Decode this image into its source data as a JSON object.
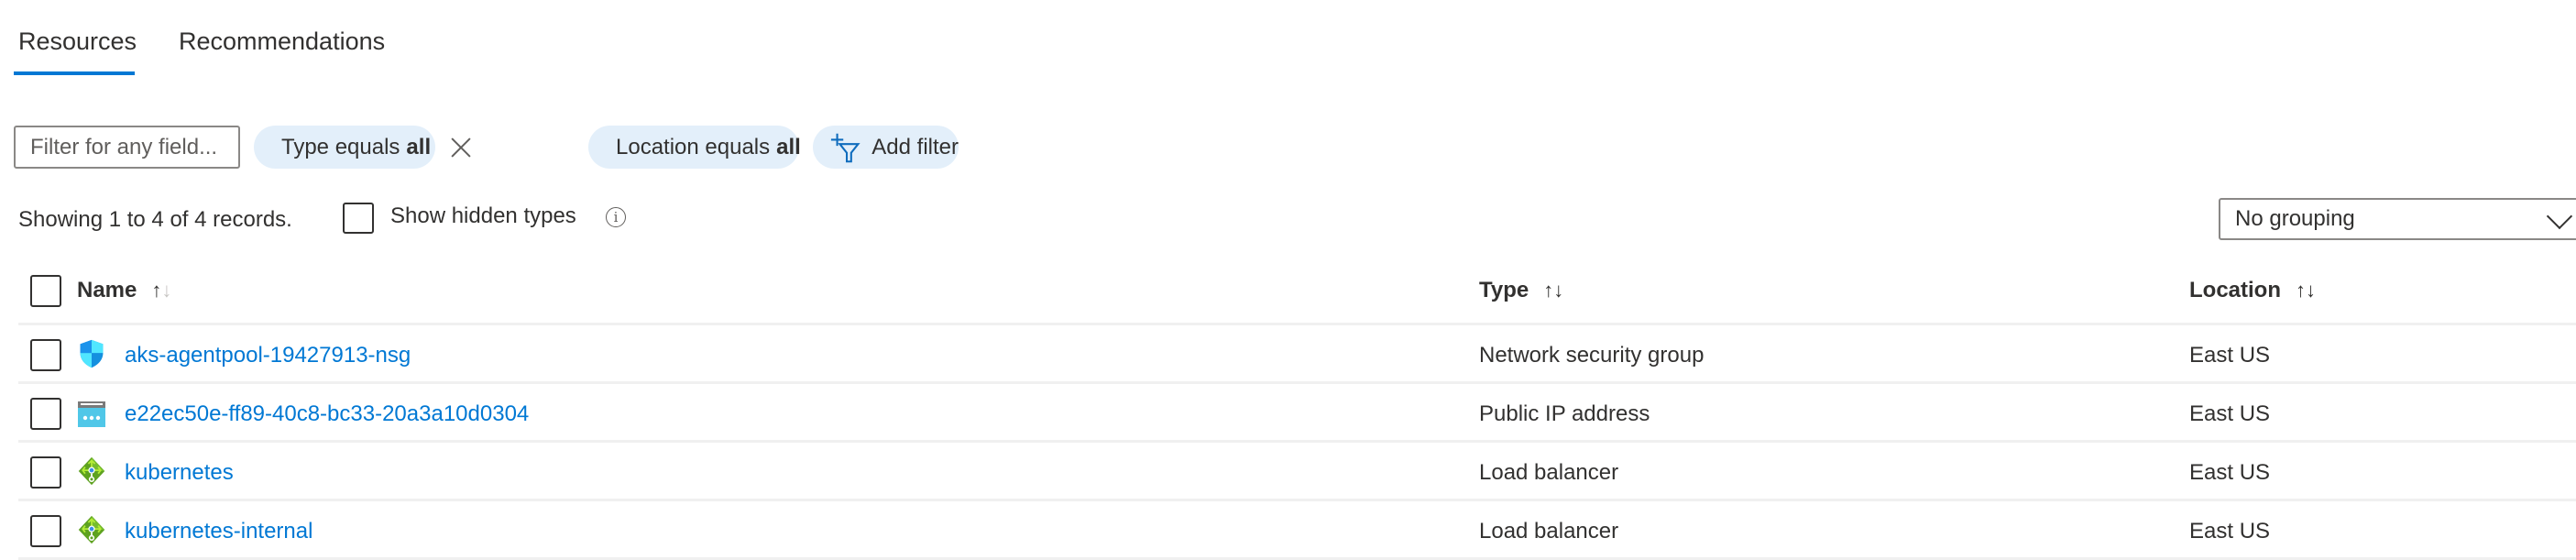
{
  "tabs": [
    {
      "label": "Resources",
      "active": true
    },
    {
      "label": "Recommendations",
      "active": false
    }
  ],
  "filters": {
    "search_placeholder": "Filter for any field...",
    "search_value": "",
    "pills": [
      {
        "prefix": "Type equals",
        "value": "all"
      },
      {
        "prefix": "Location equals",
        "value": "all"
      }
    ],
    "add_filter_label": "Add filter"
  },
  "summary": {
    "records_text": "Showing 1 to 4 of 4 records.",
    "show_hidden_label": "Show hidden types",
    "show_hidden_checked": false,
    "info_icon": "i"
  },
  "grouping": {
    "selected": "No grouping"
  },
  "table": {
    "columns": [
      {
        "label": "Name",
        "sort": "ascending"
      },
      {
        "label": "Type",
        "sort": "none"
      },
      {
        "label": "Location",
        "sort": "none"
      }
    ],
    "sort_up": "↑",
    "sort_down": "↓",
    "rows": [
      {
        "icon": "network-security-group-icon",
        "name": "aks-agentpool-19427913-nsg",
        "type": "Network security group",
        "location": "East US"
      },
      {
        "icon": "public-ip-address-icon",
        "name": "e22ec50e-ff89-40c8-bc33-20a3a10d0304",
        "type": "Public IP address",
        "location": "East US"
      },
      {
        "icon": "load-balancer-icon",
        "name": "kubernetes",
        "type": "Load balancer",
        "location": "East US"
      },
      {
        "icon": "load-balancer-icon",
        "name": "kubernetes-internal",
        "type": "Load balancer",
        "location": "East US"
      }
    ]
  },
  "colors": {
    "accent": "#0078d4",
    "pill_bg": "#e3effa",
    "text": "#323130",
    "link": "#0078d4",
    "load_balancer_green": "#5ea220",
    "public_ip_cyan": "#50c7e8",
    "nsg_blue": "#1490df"
  }
}
